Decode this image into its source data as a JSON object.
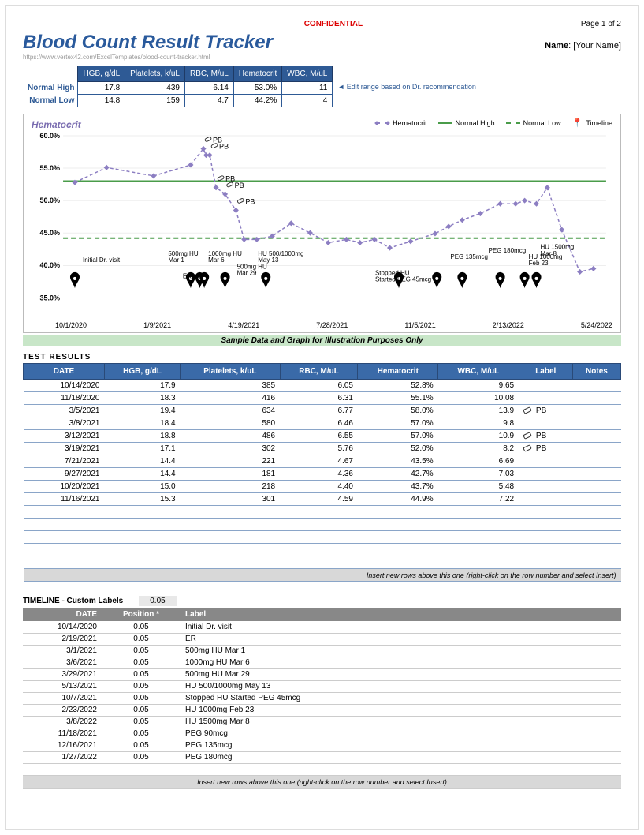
{
  "header": {
    "confidential": "CONFIDENTIAL",
    "page": "Page 1 of 2"
  },
  "title": "Blood Count Result Tracker",
  "name_label": "Name",
  "name_value": "[Your Name]",
  "url": "https://www.vertex42.com/ExcelTemplates/blood-count-tracker.html",
  "range_cols": [
    "HGB, g/dL",
    "Platelets, k/uL",
    "RBC, M/uL",
    "Hematocrit",
    "WBC, M/uL"
  ],
  "range_rows": [
    {
      "label": "Normal High",
      "vals": [
        "17.8",
        "439",
        "6.14",
        "53.0%",
        "11"
      ]
    },
    {
      "label": "Normal Low",
      "vals": [
        "14.8",
        "159",
        "4.7",
        "44.2%",
        "4"
      ]
    }
  ],
  "range_note": "◄ Edit range based on Dr. recommendation",
  "chart": {
    "title": "Hematocrit",
    "legend": [
      "Hematocrit",
      "Normal High",
      "Normal Low",
      "Timeline"
    ]
  },
  "chart_data": {
    "type": "line",
    "title": "Hematocrit",
    "xlabel": "",
    "ylabel": "",
    "ylim": [
      0.35,
      0.6
    ],
    "x_ticks": [
      "10/1/2020",
      "1/9/2021",
      "4/19/2021",
      "7/28/2021",
      "11/5/2021",
      "2/13/2022",
      "5/24/2022"
    ],
    "y_ticks": [
      "35.0%",
      "40.0%",
      "45.0%",
      "50.0%",
      "55.0%",
      "60.0%"
    ],
    "reference_lines": {
      "normal_high": 0.53,
      "normal_low": 0.442
    },
    "series": [
      {
        "name": "Hematocrit",
        "points": [
          {
            "date": "10/14/2020",
            "value": 0.528
          },
          {
            "date": "11/18/2020",
            "value": 0.551
          },
          {
            "date": "1/9/2021",
            "value": 0.538
          },
          {
            "date": "2/19/2021",
            "value": 0.555
          },
          {
            "date": "3/5/2021",
            "value": 0.58,
            "label": "PB"
          },
          {
            "date": "3/8/2021",
            "value": 0.57
          },
          {
            "date": "3/12/2021",
            "value": 0.57,
            "label": "PB"
          },
          {
            "date": "3/19/2021",
            "value": 0.52,
            "label": "PB"
          },
          {
            "date": "3/29/2021",
            "value": 0.51,
            "label": "PB"
          },
          {
            "date": "4/10/2021",
            "value": 0.485,
            "label": "PB"
          },
          {
            "date": "4/19/2021",
            "value": 0.44
          },
          {
            "date": "5/3/2021",
            "value": 0.44
          },
          {
            "date": "5/20/2021",
            "value": 0.445
          },
          {
            "date": "6/10/2021",
            "value": 0.465
          },
          {
            "date": "7/1/2021",
            "value": 0.45
          },
          {
            "date": "7/21/2021",
            "value": 0.435
          },
          {
            "date": "8/10/2021",
            "value": 0.44
          },
          {
            "date": "8/25/2021",
            "value": 0.435
          },
          {
            "date": "9/10/2021",
            "value": 0.44
          },
          {
            "date": "9/27/2021",
            "value": 0.427
          },
          {
            "date": "10/20/2021",
            "value": 0.437
          },
          {
            "date": "11/16/2021",
            "value": 0.449
          },
          {
            "date": "12/1/2021",
            "value": 0.46
          },
          {
            "date": "12/16/2021",
            "value": 0.47
          },
          {
            "date": "1/5/2022",
            "value": 0.48
          },
          {
            "date": "1/27/2022",
            "value": 0.495
          },
          {
            "date": "2/13/2022",
            "value": 0.495
          },
          {
            "date": "2/23/2022",
            "value": 0.5
          },
          {
            "date": "3/8/2022",
            "value": 0.495
          },
          {
            "date": "3/20/2022",
            "value": 0.52
          },
          {
            "date": "4/5/2022",
            "value": 0.455
          },
          {
            "date": "4/25/2022",
            "value": 0.39
          },
          {
            "date": "5/10/2022",
            "value": 0.395
          }
        ]
      }
    ],
    "timeline_markers": [
      {
        "date": "10/14/2020",
        "label": "Initial Dr. visit"
      },
      {
        "date": "2/19/2021",
        "label": "ER"
      },
      {
        "date": "3/1/2021",
        "label": "500mg HU   Mar 1"
      },
      {
        "date": "3/6/2021",
        "label": "1000mg HU   Mar 6"
      },
      {
        "date": "3/29/2021",
        "label": "500mg HU   Mar 29"
      },
      {
        "date": "5/13/2021",
        "label": "HU 500/1000mg   May 13"
      },
      {
        "date": "10/7/2021",
        "label": "Stopped HU   Started PEG 45mcg"
      },
      {
        "date": "11/18/2021",
        "label": "PEG 90mcg"
      },
      {
        "date": "12/16/2021",
        "label": "PEG 135mcg"
      },
      {
        "date": "1/27/2022",
        "label": "PEG 180mcg"
      },
      {
        "date": "2/23/2022",
        "label": "HU 1000mg   Feb 23"
      },
      {
        "date": "3/8/2022",
        "label": "HU 1500mg   Mar 8"
      }
    ]
  },
  "sample_note": "Sample Data and Graph for Illustration Purposes Only",
  "results_title": "TEST RESULTS",
  "results_cols": [
    "DATE",
    "HGB, g/dL",
    "Platelets, k/uL",
    "RBC, M/uL",
    "Hematocrit",
    "WBC, M/uL",
    "Label",
    "Notes"
  ],
  "results": [
    {
      "date": "10/14/2020",
      "hgb": "17.9",
      "plt": "385",
      "rbc": "6.05",
      "hct": "52.8%",
      "wbc": "9.65",
      "label": "",
      "notes": ""
    },
    {
      "date": "11/18/2020",
      "hgb": "18.3",
      "plt": "416",
      "rbc": "6.31",
      "hct": "55.1%",
      "wbc": "10.08",
      "label": "",
      "notes": ""
    },
    {
      "date": "3/5/2021",
      "hgb": "19.4",
      "plt": "634",
      "rbc": "6.77",
      "hct": "58.0%",
      "wbc": "13.9",
      "label": "PB",
      "notes": ""
    },
    {
      "date": "3/8/2021",
      "hgb": "18.4",
      "plt": "580",
      "rbc": "6.46",
      "hct": "57.0%",
      "wbc": "9.8",
      "label": "",
      "notes": ""
    },
    {
      "date": "3/12/2021",
      "hgb": "18.8",
      "plt": "486",
      "rbc": "6.55",
      "hct": "57.0%",
      "wbc": "10.9",
      "label": "PB",
      "notes": ""
    },
    {
      "date": "3/19/2021",
      "hgb": "17.1",
      "plt": "302",
      "rbc": "5.76",
      "hct": "52.0%",
      "wbc": "8.2",
      "label": "PB",
      "notes": ""
    },
    {
      "date": "7/21/2021",
      "hgb": "14.4",
      "plt": "221",
      "rbc": "4.67",
      "hct": "43.5%",
      "wbc": "6.69",
      "label": "",
      "notes": ""
    },
    {
      "date": "9/27/2021",
      "hgb": "14.4",
      "plt": "181",
      "rbc": "4.36",
      "hct": "42.7%",
      "wbc": "7.03",
      "label": "",
      "notes": ""
    },
    {
      "date": "10/20/2021",
      "hgb": "15.0",
      "plt": "218",
      "rbc": "4.40",
      "hct": "43.7%",
      "wbc": "5.48",
      "label": "",
      "notes": ""
    },
    {
      "date": "11/16/2021",
      "hgb": "15.3",
      "plt": "301",
      "rbc": "4.59",
      "hct": "44.9%",
      "wbc": "7.22",
      "label": "",
      "notes": ""
    }
  ],
  "insert_note": "Insert new rows above this one (right-click on the row number and select Insert)",
  "timeline_title": "TIMELINE - Custom Labels",
  "timeline_val": "0.05",
  "timeline_cols": [
    "DATE",
    "Position *",
    "Label"
  ],
  "timeline": [
    {
      "date": "10/14/2020",
      "pos": "0.05",
      "label": "Initial Dr. visit"
    },
    {
      "date": "2/19/2021",
      "pos": "0.05",
      "label": "ER"
    },
    {
      "date": "3/1/2021",
      "pos": "0.05",
      "label": "500mg HU   Mar 1"
    },
    {
      "date": "3/6/2021",
      "pos": "0.05",
      "label": "1000mg HU   Mar 6"
    },
    {
      "date": "3/29/2021",
      "pos": "0.05",
      "label": "500mg HU   Mar 29"
    },
    {
      "date": "5/13/2021",
      "pos": "0.05",
      "label": "HU 500/1000mg   May 13"
    },
    {
      "date": "10/7/2021",
      "pos": "0.05",
      "label": "Stopped HU   Started PEG 45mcg"
    },
    {
      "date": "2/23/2022",
      "pos": "0.05",
      "label": "HU 1000mg   Feb 23"
    },
    {
      "date": "3/8/2022",
      "pos": "0.05",
      "label": "HU 1500mg   Mar 8"
    },
    {
      "date": "11/18/2021",
      "pos": "0.05",
      "label": "PEG 90mcg"
    },
    {
      "date": "12/16/2021",
      "pos": "0.05",
      "label": "PEG 135mcg"
    },
    {
      "date": "1/27/2022",
      "pos": "0.05",
      "label": "PEG 180mcg"
    }
  ]
}
